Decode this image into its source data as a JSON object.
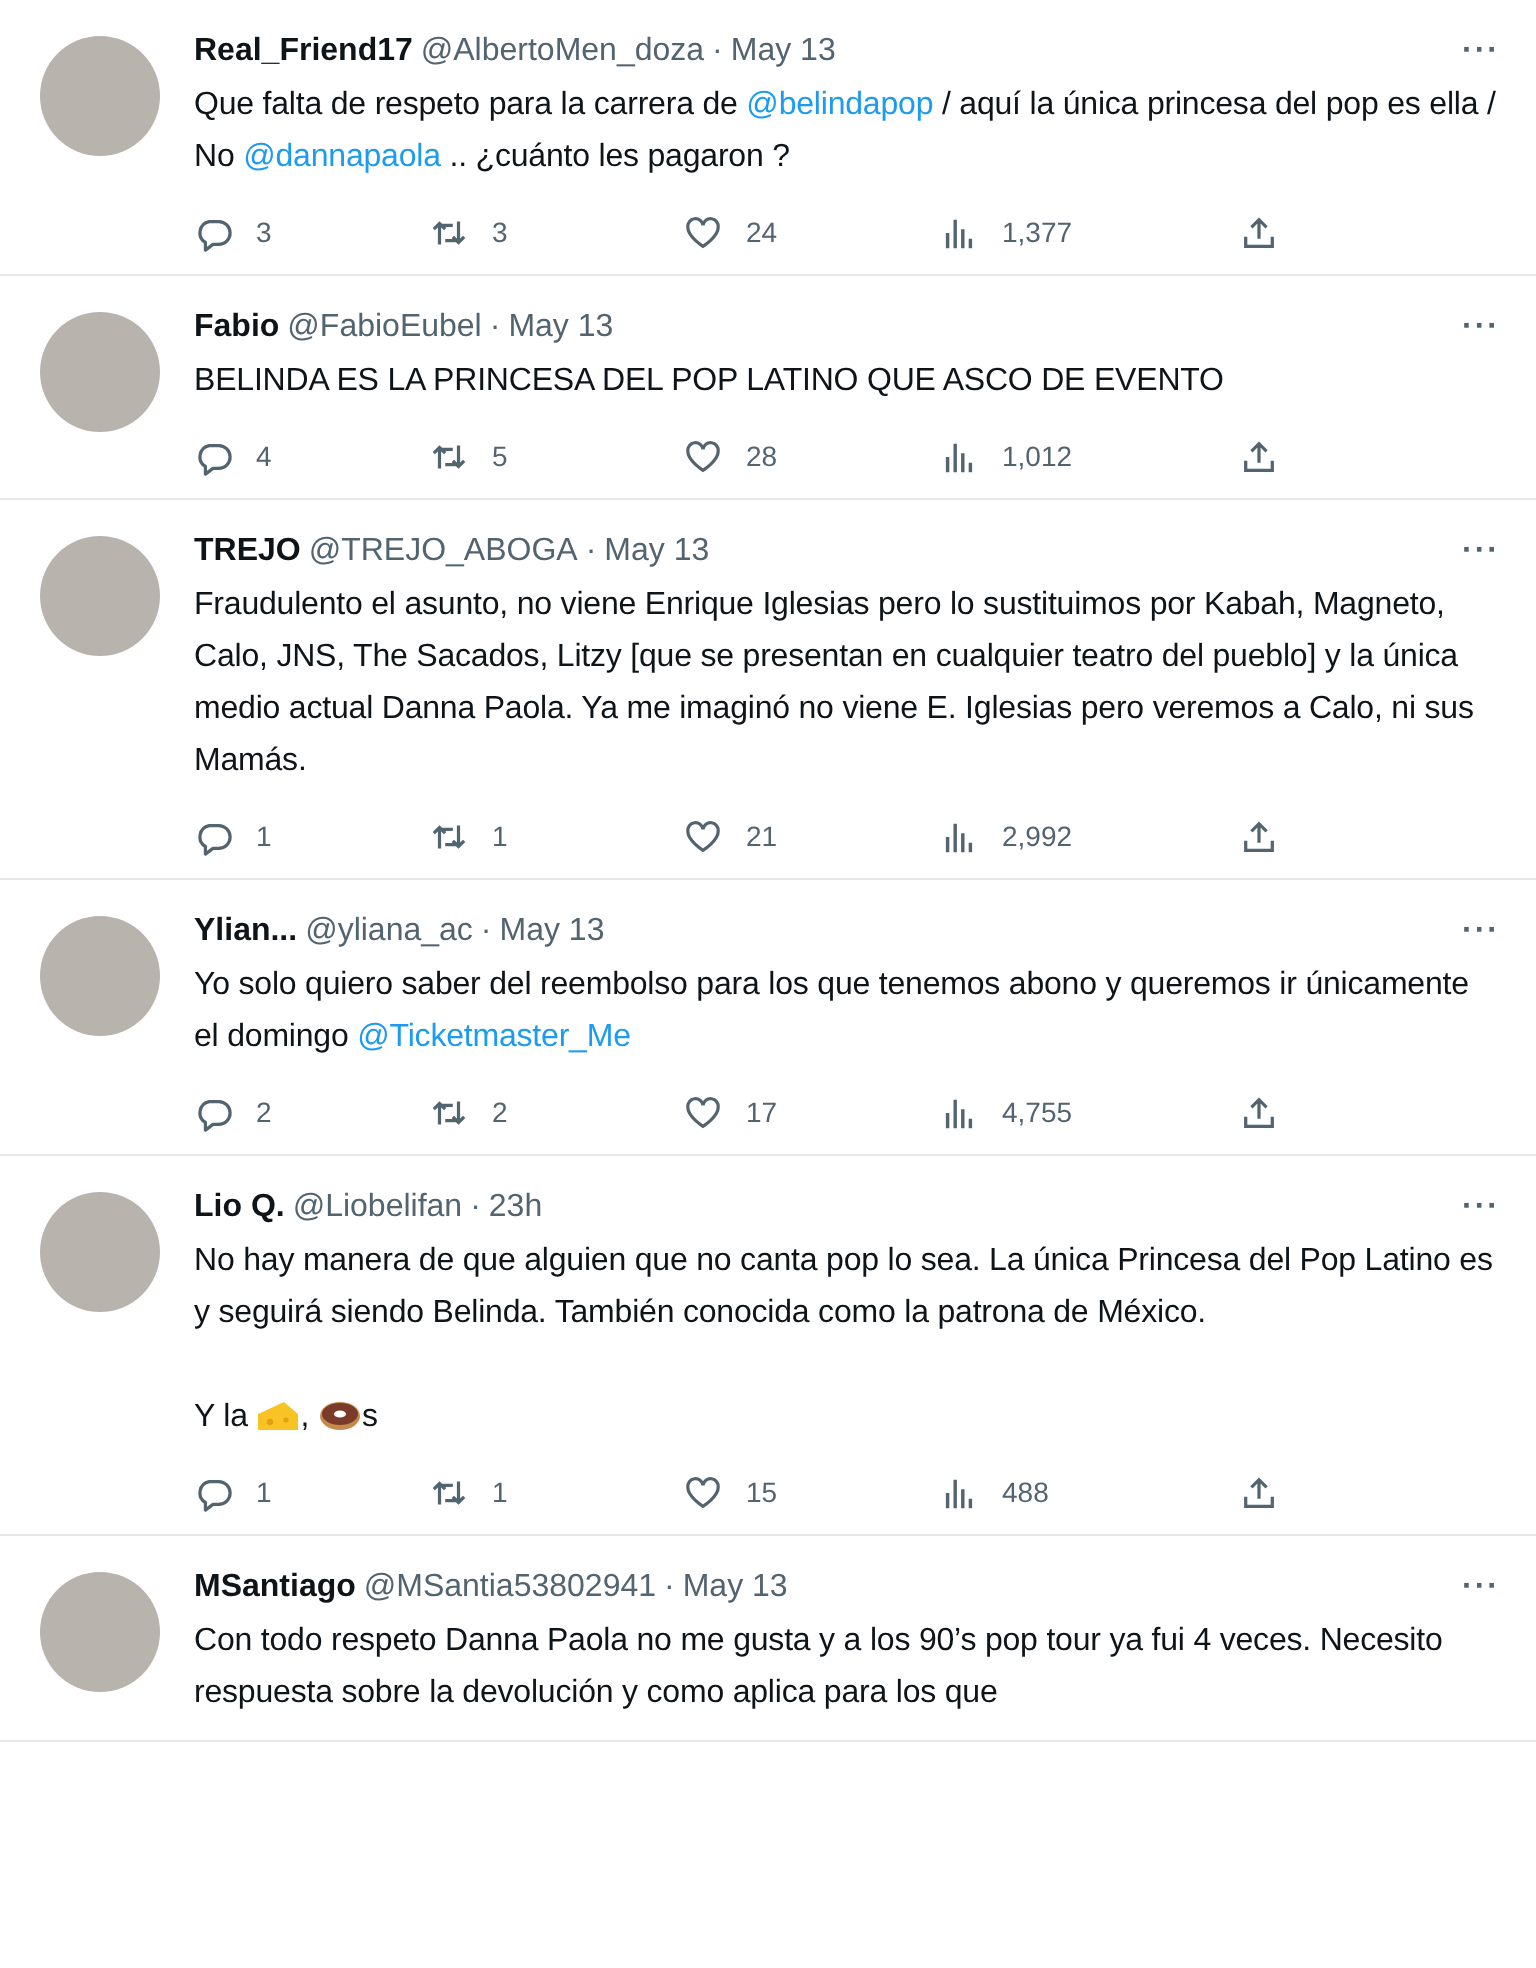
{
  "tweets": [
    {
      "name": "Real_Friend17",
      "handle": "@AlbertoMen_doza",
      "separator": "·",
      "time": "May 13",
      "more": "···",
      "paragraphs": [
        [
          {
            "kind": "text",
            "text": "Que falta de respeto para la carrera de "
          },
          {
            "kind": "mention",
            "text": "@belindapop"
          },
          {
            "kind": "text",
            "text": " / aquí la única princesa del pop es ella / No "
          },
          {
            "kind": "mention",
            "text": "@dannapaola"
          },
          {
            "kind": "text",
            "text": "  .. ¿cuánto les pagaron ?"
          }
        ]
      ],
      "replies": "3",
      "retweets": "3",
      "likes": "24",
      "views": "1,377"
    },
    {
      "name": "Fabio",
      "handle": "@FabioEubel",
      "separator": "·",
      "time": "May 13",
      "more": "···",
      "paragraphs": [
        [
          {
            "kind": "text",
            "text": "BELINDA ES LA PRINCESA DEL POP LATINO QUE ASCO DE EVENTO"
          }
        ]
      ],
      "replies": "4",
      "retweets": "5",
      "likes": "28",
      "views": "1,012"
    },
    {
      "name": "TREJO",
      "handle": "@TREJO_ABOGA",
      "separator": "·",
      "time": "May 13",
      "more": "···",
      "paragraphs": [
        [
          {
            "kind": "text",
            "text": "Fraudulento el asunto, no viene Enrique Iglesias pero lo sustituimos por Kabah, Magneto, Calo, JNS, The Sacados, Litzy [que se presentan en cualquier teatro del pueblo] y la única medio actual Danna Paola.  Ya me imaginó no viene E. Iglesias pero veremos a Calo, ni sus Mamás."
          }
        ]
      ],
      "replies": "1",
      "retweets": "1",
      "likes": "21",
      "views": "2,992"
    },
    {
      "name": "Ylian...",
      "handle": "@yliana_ac",
      "separator": "·",
      "time": "May 13",
      "more": "···",
      "paragraphs": [
        [
          {
            "kind": "text",
            "text": "Yo solo quiero saber del reembolso para los que tenemos abono y queremos ir únicamente el domingo "
          },
          {
            "kind": "mention",
            "text": "@Ticketmaster_Me"
          }
        ]
      ],
      "replies": "2",
      "retweets": "2",
      "likes": "17",
      "views": "4,755"
    },
    {
      "name": "Lio Q.",
      "handle": "@Liobelifan",
      "separator": "·",
      "time": "23h",
      "more": "···",
      "paragraphs": [
        [
          {
            "kind": "text",
            "text": "No hay manera de que alguien que no canta pop lo sea. La única Princesa del Pop Latino es y seguirá siendo Belinda. También conocida como la patrona de México."
          }
        ],
        [
          {
            "kind": "text",
            "text": "Y la "
          },
          {
            "kind": "cheese"
          },
          {
            "kind": "text",
            "text": ", "
          },
          {
            "kind": "donut"
          },
          {
            "kind": "text",
            "text": "s"
          }
        ]
      ],
      "replies": "1",
      "retweets": "1",
      "likes": "15",
      "views": "488"
    },
    {
      "name": "MSantiago",
      "handle": "@MSantia53802941",
      "separator": "·",
      "time": "May 13",
      "more": "···",
      "paragraphs": [
        [
          {
            "kind": "text",
            "text": "Con todo respeto Danna Paola no me gusta y a los 90’s pop tour ya fui 4 veces. Necesito respuesta sobre la devolución y como aplica para los que"
          }
        ]
      ]
    }
  ]
}
